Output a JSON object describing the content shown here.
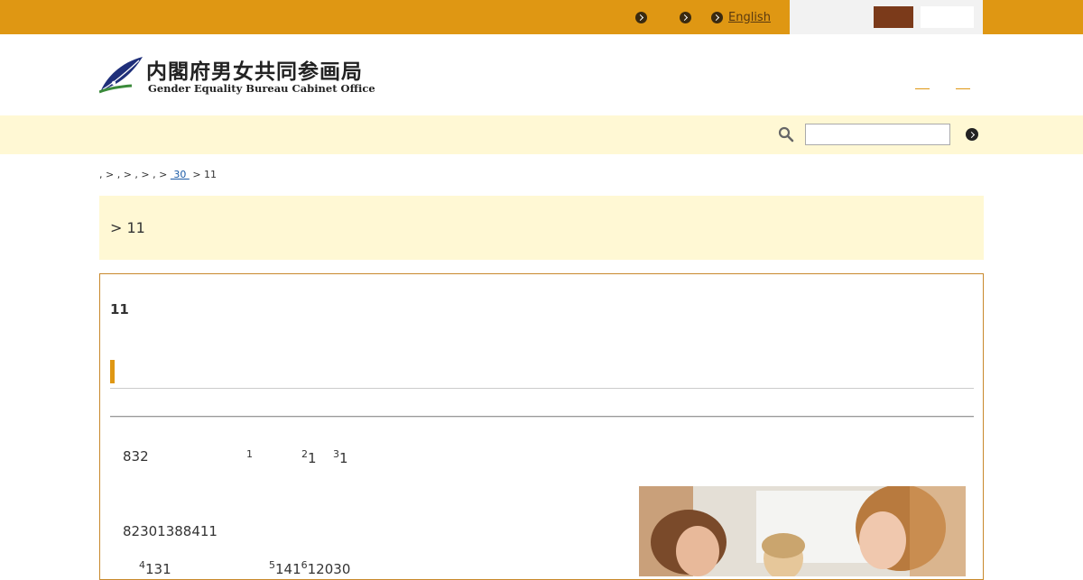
{
  "utility_nav": {
    "link1": "  ",
    "link2": "",
    "english": "English"
  },
  "header": {
    "logo_jp": "内閣府男女共同参画局",
    "logo_en": "Gender Equality Bureau Cabinet Office"
  },
  "search": {
    "placeholder": ""
  },
  "breadcrumb": {
    "prefix": ", > , > , > , > ",
    "link": " 30 ",
    "suffix": " > 11"
  },
  "page": {
    "title": "> 11",
    "heading": "11"
  },
  "body_text": {
    "line1_a": "832",
    "sup1": "1",
    "sup2": "2",
    "val2": "1",
    "sup3": "3",
    "val3": "1",
    "line2": "82301388411",
    "sup4": "4",
    "val4": "131",
    "sup5": "5",
    "val5": "141",
    "sup6": "6",
    "val6": "12030"
  },
  "colors": {
    "topbar": "#df9713",
    "band": "#fff8d4",
    "font_button_active": "#7b3a1a",
    "content_border": "#c8892c"
  },
  "icons": {
    "logo": "feather-logo-icon",
    "search": "magnifier-icon",
    "go": "arrow-circle-icon"
  }
}
